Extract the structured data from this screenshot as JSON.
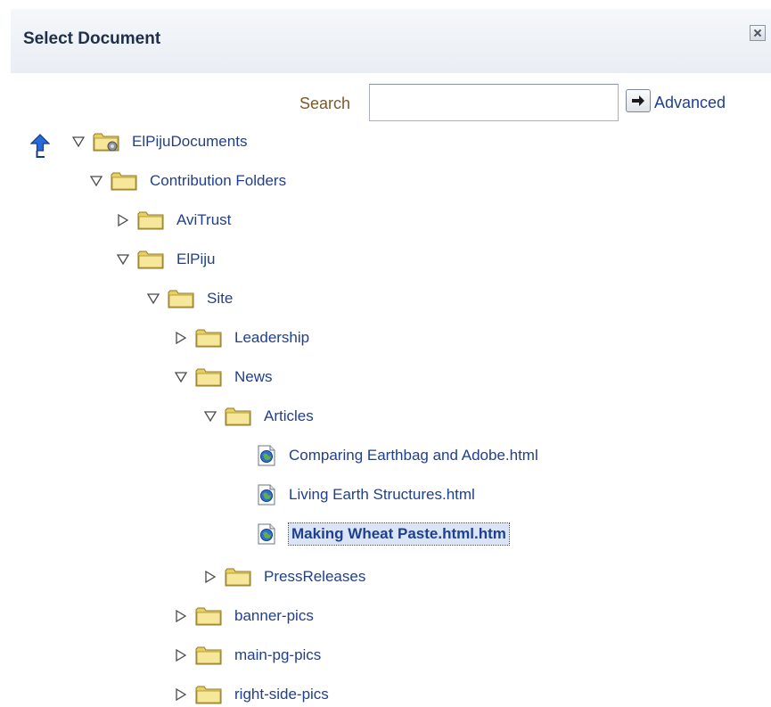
{
  "dialog": {
    "title": "Select Document"
  },
  "search": {
    "label": "Search",
    "value": "",
    "placeholder": "",
    "advanced_label": "Advanced"
  },
  "tree": {
    "nodes": [
      {
        "label": "ElPijuDocuments",
        "type": "root-folder",
        "state": "expanded"
      },
      {
        "label": "Contribution Folders",
        "type": "folder",
        "state": "expanded"
      },
      {
        "label": "AviTrust",
        "type": "folder",
        "state": "collapsed"
      },
      {
        "label": "ElPiju",
        "type": "folder",
        "state": "expanded"
      },
      {
        "label": "Site",
        "type": "folder",
        "state": "expanded"
      },
      {
        "label": "Leadership",
        "type": "folder",
        "state": "collapsed"
      },
      {
        "label": "News",
        "type": "folder",
        "state": "expanded"
      },
      {
        "label": "Articles",
        "type": "folder",
        "state": "expanded"
      },
      {
        "label": "Comparing Earthbag and Adobe.html",
        "type": "document"
      },
      {
        "label": "Living Earth Structures.html",
        "type": "document"
      },
      {
        "label": "Making Wheat Paste.html.htm",
        "type": "document",
        "selected": true
      },
      {
        "label": "PressReleases",
        "type": "folder",
        "state": "collapsed"
      },
      {
        "label": "banner-pics",
        "type": "folder",
        "state": "collapsed"
      },
      {
        "label": "main-pg-pics",
        "type": "folder",
        "state": "collapsed"
      },
      {
        "label": "right-side-pics",
        "type": "folder",
        "state": "collapsed"
      }
    ]
  },
  "icons": {
    "up": "up-arrow-icon",
    "close": "close-icon",
    "go": "arrow-right-icon",
    "folder": "folder-icon",
    "document": "web-document-icon",
    "expanded": "triangle-down-icon",
    "collapsed": "triangle-right-icon"
  },
  "colors": {
    "link": "#1f3f8f",
    "search_label": "#7a5a2b",
    "selection_bg": "#d9e4f5",
    "folder_fill": "#f1df7b",
    "title_text": "#20304a"
  }
}
